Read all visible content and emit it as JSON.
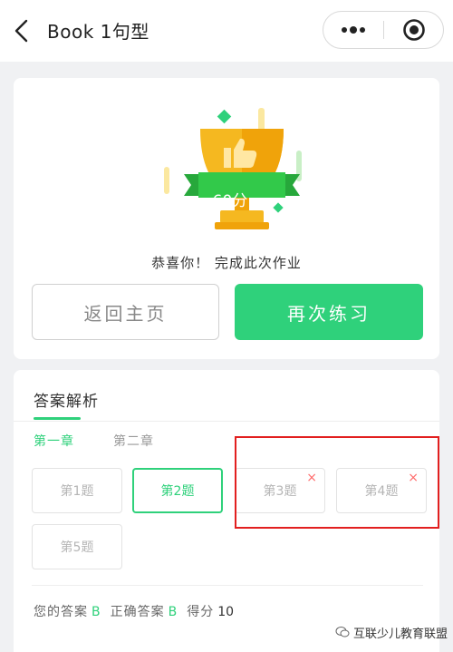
{
  "header": {
    "title": "Book 1句型",
    "icons": [
      "back-arrow-icon",
      "more-icon",
      "target-icon"
    ]
  },
  "result": {
    "score": "60分",
    "message": "恭喜你！ 完成此次作业",
    "home_button": "返回主页",
    "retry_button": "再次练习",
    "colors": {
      "accent": "#2fd17b",
      "trophy": "#f5b820",
      "ribbon": "#32c94a"
    }
  },
  "analysis": {
    "title": "答案解析",
    "chapters": [
      "第一章",
      "第二章"
    ],
    "questions": [
      {
        "label": "第1题",
        "state": "normal"
      },
      {
        "label": "第2题",
        "state": "active"
      },
      {
        "label": "第3题",
        "state": "wrong"
      },
      {
        "label": "第4题",
        "state": "wrong"
      },
      {
        "label": "第5题",
        "state": "normal"
      }
    ],
    "wrong_mark": "×",
    "your_answer_label": "您的答案",
    "your_answer": "B",
    "correct_answer_label": "正确答案",
    "correct_answer": "B",
    "score_label": "得分",
    "score_value": "10"
  },
  "watermark": {
    "text": "互联少儿教育联盟"
  }
}
